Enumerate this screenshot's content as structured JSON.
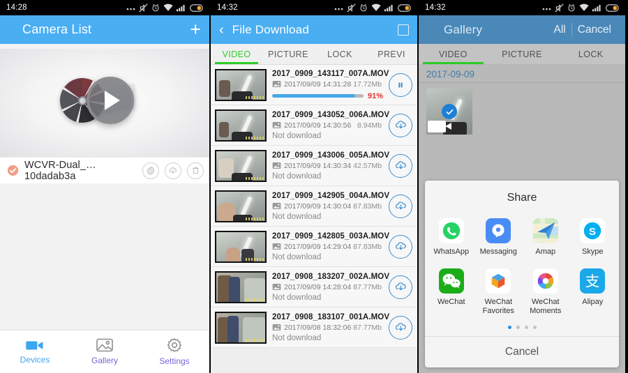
{
  "panel1": {
    "statusbar": {
      "time": "14:28",
      "icons": [
        "more-dots-icon",
        "vibrate-off-icon",
        "alarm-icon",
        "wifi-icon",
        "signal-icon",
        "battery-icon"
      ]
    },
    "appbar": {
      "title": "Camera List",
      "add_label": "+"
    },
    "device": {
      "name": "WCVR-Dual_…10dadab3a",
      "status_icon": "connected-check-icon",
      "actions": [
        "gear-icon",
        "cloud-download-icon",
        "trash-icon"
      ]
    },
    "bottom_nav": [
      {
        "label": "Devices",
        "icon": "camcorder-icon",
        "active": true
      },
      {
        "label": "Gallery",
        "icon": "image-icon",
        "active": false
      },
      {
        "label": "Settings",
        "icon": "gear-icon",
        "active": false
      }
    ]
  },
  "panel2": {
    "statusbar": {
      "time": "14:32"
    },
    "appbar": {
      "title": "File Download",
      "back_icon": "chevron-left-icon",
      "select_icon": "select-square-icon"
    },
    "tabs": [
      {
        "label": "VIDEO",
        "active": true
      },
      {
        "label": "PICTURE",
        "active": false
      },
      {
        "label": "LOCK",
        "active": false
      },
      {
        "label": "PREVI",
        "active": false
      }
    ],
    "files": [
      {
        "name": "2017_0909_143117_007A.MOV",
        "date": "2017/09/09 14:31:28",
        "size": "17.72Mb",
        "progress": 91,
        "progress_label": "91%",
        "status": "",
        "action_icon": "pause-icon"
      },
      {
        "name": "2017_0909_143052_006A.MOV",
        "date": "2017/09/09 14:30:56",
        "size": "8.94Mb",
        "progress": null,
        "progress_label": "",
        "status": "Not download",
        "action_icon": "cloud-download-icon"
      },
      {
        "name": "2017_0909_143006_005A.MOV",
        "date": "2017/09/09 14:30:34",
        "size": "42.57Mb",
        "progress": null,
        "progress_label": "",
        "status": "Not download",
        "action_icon": "cloud-download-icon"
      },
      {
        "name": "2017_0909_142905_004A.MOV",
        "date": "2017/09/09 14:30:04",
        "size": "87.83Mb",
        "progress": null,
        "progress_label": "",
        "status": "Not download",
        "action_icon": "cloud-download-icon"
      },
      {
        "name": "2017_0909_142805_003A.MOV",
        "date": "2017/09/09 14:29:04",
        "size": "87.83Mb",
        "progress": null,
        "progress_label": "",
        "status": "Not download",
        "action_icon": "cloud-download-icon"
      },
      {
        "name": "2017_0908_183207_002A.MOV",
        "date": "2017/09/09 14:28:04",
        "size": "87.77Mb",
        "progress": null,
        "progress_label": "",
        "status": "Not download",
        "action_icon": "cloud-download-icon"
      },
      {
        "name": "2017_0908_183107_001A.MOV",
        "date": "2017/09/08 18:32:06",
        "size": "87.77Mb",
        "progress": null,
        "progress_label": "",
        "status": "Not download",
        "action_icon": "cloud-download-icon"
      }
    ]
  },
  "panel3": {
    "statusbar": {
      "time": "14:32"
    },
    "appbar": {
      "title": "Gallery",
      "all_label": "All",
      "cancel_label": "Cancel"
    },
    "tabs": [
      {
        "label": "VIDEO",
        "active": true
      },
      {
        "label": "PICTURE",
        "active": false
      },
      {
        "label": "LOCK",
        "active": false
      }
    ],
    "gallery": {
      "date_header": "2017-09-09",
      "item_selected": true,
      "item_type_icon": "video-badge-icon"
    },
    "share_sheet": {
      "title": "Share",
      "cancel_label": "Cancel",
      "page_dots": 4,
      "active_dot": 1,
      "apps": [
        {
          "label": "WhatsApp",
          "icon": "whatsapp-icon"
        },
        {
          "label": "Messaging",
          "icon": "messaging-icon"
        },
        {
          "label": "Amap",
          "icon": "amap-icon"
        },
        {
          "label": "Skype",
          "icon": "skype-icon"
        },
        {
          "label": "WeChat",
          "icon": "wechat-icon"
        },
        {
          "label": "WeChat Favorites",
          "icon": "wechat-favorites-icon"
        },
        {
          "label": "WeChat Moments",
          "icon": "wechat-moments-icon"
        },
        {
          "label": "Alipay",
          "icon": "alipay-icon"
        }
      ]
    }
  },
  "colors": {
    "accent_blue": "#4aaef2",
    "tab_green": "#2ecc27",
    "progress_red": "#e03030",
    "action_blue": "#3d8fd0"
  }
}
